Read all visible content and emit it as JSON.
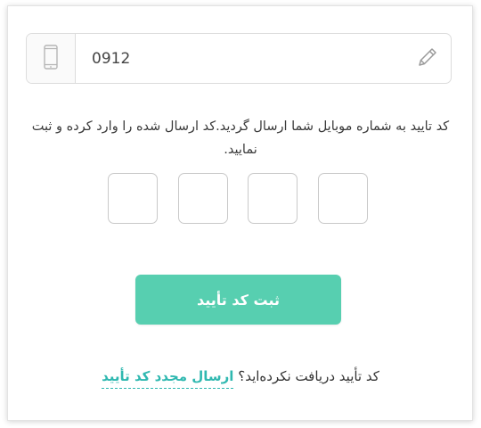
{
  "phone": {
    "value": "0912",
    "icon": "mobile-phone-icon",
    "edit_icon": "pencil-icon"
  },
  "message": {
    "text": "کد تایید به شماره موبایل شما ارسال گردید.کد ارسال شده را وارد کرده و ثبت نمایید."
  },
  "code_inputs": {
    "count": 4,
    "values": [
      "",
      "",
      "",
      ""
    ]
  },
  "submit": {
    "label": "ثبت کد تأیید",
    "color": "#57cfb0"
  },
  "resend": {
    "question": "کد تأیید دریافت نکرده‌اید؟",
    "link_label": "ارسال مجدد کد تأیید",
    "link_color": "#2fb8b0"
  }
}
